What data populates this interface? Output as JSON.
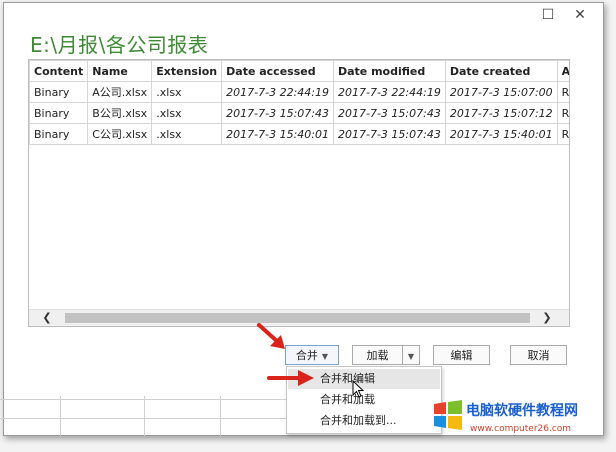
{
  "window": {
    "title": "E:\\月报\\各公司报表",
    "maximize_glyph": "☐",
    "close_glyph": "✕"
  },
  "table": {
    "columns": [
      "Content",
      "Name",
      "Extension",
      "Date accessed",
      "Date modified",
      "Date created",
      "Attribu"
    ],
    "rows": [
      [
        "Binary",
        "A公司.xlsx",
        ".xlsx",
        "2017-7-3 22:44:19",
        "2017-7-3 22:44:19",
        "2017-7-3 15:07:00",
        "Record"
      ],
      [
        "Binary",
        "B公司.xlsx",
        ".xlsx",
        "2017-7-3 15:07:43",
        "2017-7-3 15:07:43",
        "2017-7-3 15:07:12",
        "Record"
      ],
      [
        "Binary",
        "C公司.xlsx",
        ".xlsx",
        "2017-7-3 15:40:01",
        "2017-7-3 15:07:43",
        "2017-7-3 15:40:01",
        "Record"
      ]
    ],
    "scroll_left_glyph": "❮",
    "scroll_right_glyph": "❯"
  },
  "buttons": {
    "combine": "合并",
    "load": "加载",
    "edit": "编辑",
    "cancel": "取消",
    "dropdown_glyph": "▼"
  },
  "dropdown_menu": {
    "items": [
      "合并和编辑",
      "合并和加载",
      "合并和加载到..."
    ]
  },
  "watermark": {
    "title": "电脑软硬件教程网",
    "url": "www.computer26.com"
  },
  "colors": {
    "title_green": "#3f8a35",
    "arrow_red": "#d9231c",
    "watermark_blue": "#1a5fd0"
  }
}
